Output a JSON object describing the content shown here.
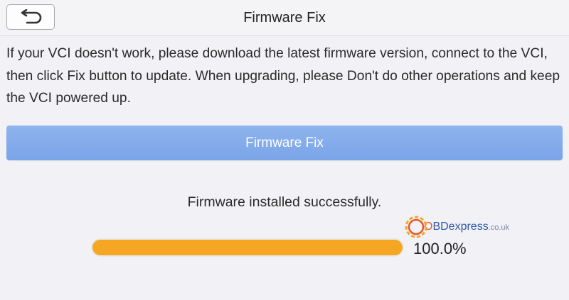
{
  "header": {
    "title": "Firmware Fix",
    "back_icon": "return-arrow-icon"
  },
  "main": {
    "description": "If your VCI doesn't work, please download the latest firmware version, connect to the VCI, then click Fix button to update. When upgrading, please Don't do other operations and keep the VCI powered up.",
    "fix_button_label": "Firmware Fix",
    "status_text": "Firmware installed successfully.",
    "progress_label": "100.0%",
    "progress_fraction": 1.0
  },
  "watermark": {
    "brand_o": "O",
    "brand_rest": "BDexpress",
    "tld": ".co.uk"
  },
  "colors": {
    "background": "#f2f1f6",
    "button": "#7aa4e8",
    "progress": "#f5a623"
  }
}
